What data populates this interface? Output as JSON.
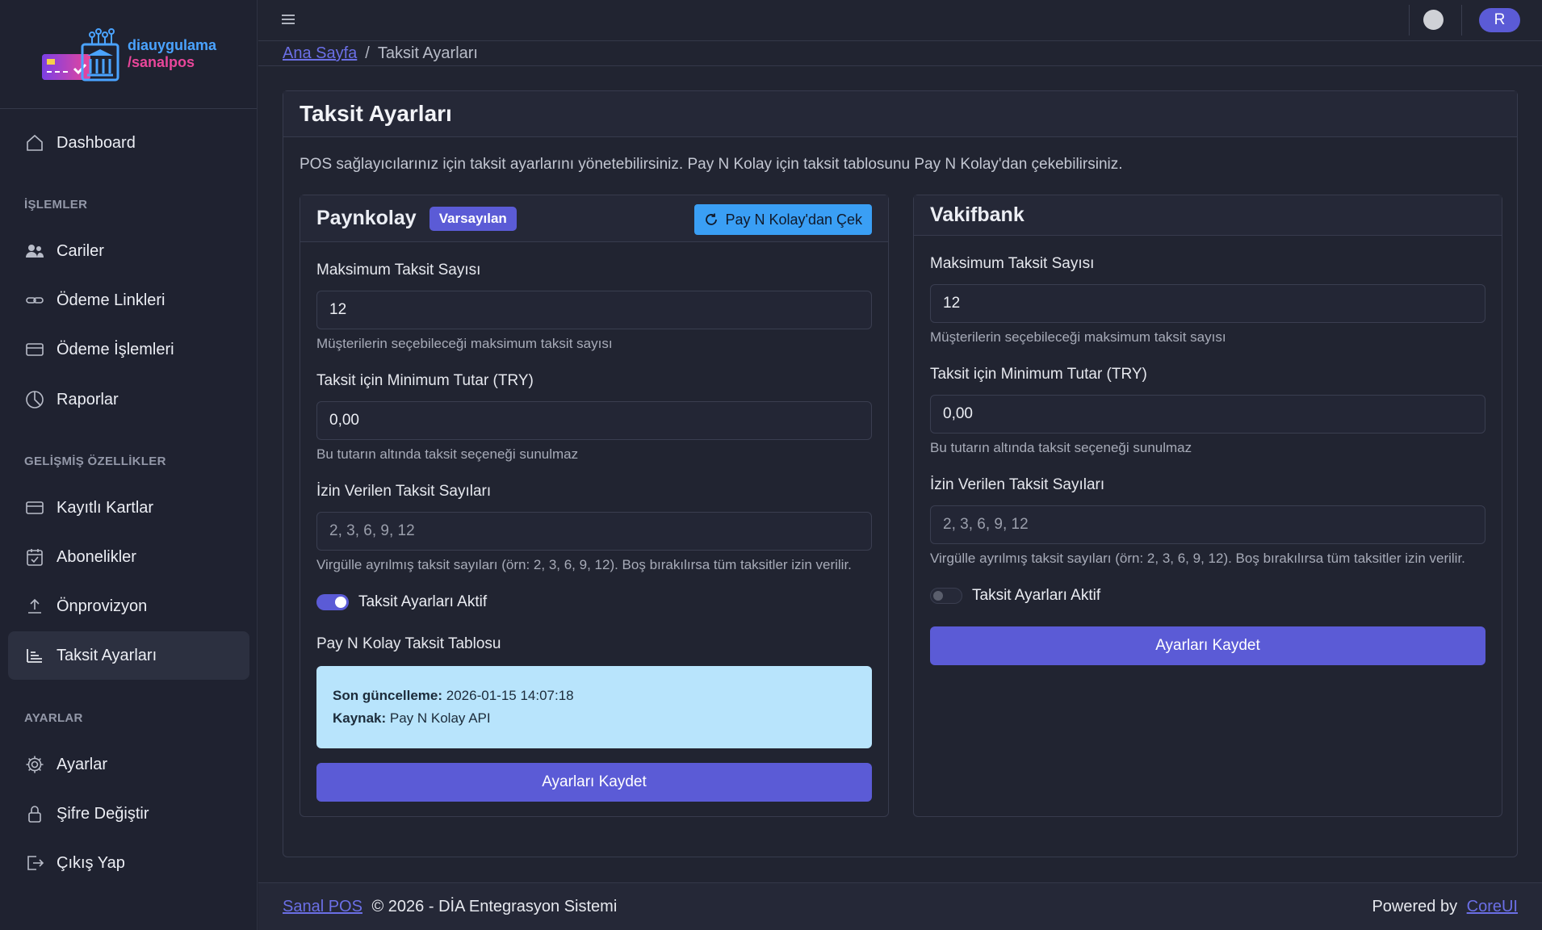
{
  "brand": {
    "line1": "diauygulama",
    "line2": "/sanalpos"
  },
  "sidebar": {
    "dashboard": "Dashboard",
    "section_ops": "İŞLEMLER",
    "cariler": "Cariler",
    "odeme_linkleri": "Ödeme Linkleri",
    "odeme_islemleri": "Ödeme İşlemleri",
    "raporlar": "Raporlar",
    "section_adv": "GELİŞMİŞ ÖZELLİKLER",
    "kayitli_kartlar": "Kayıtlı Kartlar",
    "abonelikler": "Abonelikler",
    "onprovizyon": "Önprovizyon",
    "taksit_ayarlari": "Taksit Ayarları",
    "section_settings": "AYARLAR",
    "ayarlar": "Ayarlar",
    "sifre_degistir": "Şifre Değiştir",
    "cikis_yap": "Çıkış Yap"
  },
  "header": {
    "avatar_initial": "R"
  },
  "breadcrumb": {
    "home": "Ana Sayfa",
    "separator": "/",
    "current": "Taksit Ayarları"
  },
  "main": {
    "title": "Taksit Ayarları",
    "description": "POS sağlayıcılarınız için taksit ayarlarını yönetebilirsiniz. Pay N Kolay için taksit tablosunu Pay N Kolay'dan çekebilirsiniz."
  },
  "paynkolay": {
    "title": "Paynkolay",
    "badge": "Varsayılan",
    "fetch_button": "Pay N Kolay'dan Çek",
    "max_label": "Maksimum Taksit Sayısı",
    "max_value": "12",
    "max_help": "Müşterilerin seçebileceği maksimum taksit sayısı",
    "min_label": "Taksit için Minimum Tutar (TRY)",
    "min_value": "0,00",
    "min_help": "Bu tutarın altında taksit seçeneği sunulmaz",
    "allowed_label": "İzin Verilen Taksit Sayıları",
    "allowed_placeholder": "2, 3, 6, 9, 12",
    "allowed_help": "Virgülle ayrılmış taksit sayıları (örn: 2, 3, 6, 9, 12). Boş bırakılırsa tüm taksitler izin verilir.",
    "toggle_label": "Taksit Ayarları Aktif",
    "toggle_on": true,
    "table_label": "Pay N Kolay Taksit Tablosu",
    "last_update_label": "Son güncelleme:",
    "last_update_value": "2026-01-15 14:07:18",
    "source_label": "Kaynak:",
    "source_value": "Pay N Kolay API",
    "save_button": "Ayarları Kaydet"
  },
  "vakifbank": {
    "title": "Vakifbank",
    "max_label": "Maksimum Taksit Sayısı",
    "max_value": "12",
    "max_help": "Müşterilerin seçebileceği maksimum taksit sayısı",
    "min_label": "Taksit için Minimum Tutar (TRY)",
    "min_value": "0,00",
    "min_help": "Bu tutarın altında taksit seçeneği sunulmaz",
    "allowed_label": "İzin Verilen Taksit Sayıları",
    "allowed_placeholder": "2, 3, 6, 9, 12",
    "allowed_help": "Virgülle ayrılmış taksit sayıları (örn: 2, 3, 6, 9, 12). Boş bırakılırsa tüm taksitler izin verilir.",
    "toggle_label": "Taksit Ayarları Aktif",
    "toggle_on": false,
    "save_button": "Ayarları Kaydet"
  },
  "footer": {
    "link": "Sanal POS",
    "text": "© 2026 - DİA Entegrasyon Sistemi",
    "powered": "Powered by",
    "powered_link": "CoreUI"
  },
  "colors": {
    "accent": "#5b5bd6",
    "info": "#3a9ff5",
    "info_bg": "#b8e4fc",
    "background": "#212431"
  }
}
